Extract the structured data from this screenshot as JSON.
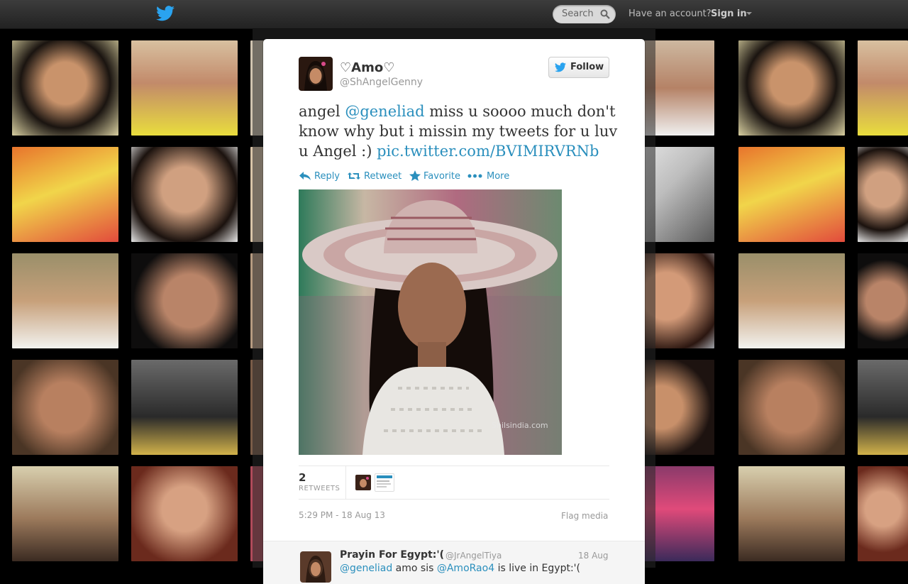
{
  "topbar": {
    "search_placeholder": "Search",
    "have_account": "Have an account?",
    "signin": "Sign in",
    "icons": [
      "twitter-bird-icon",
      "search-icon",
      "caret-down-icon"
    ]
  },
  "tweet": {
    "fullname": "♡Amo♡",
    "handle": "@ShAngelGenny",
    "follow_label": "Follow",
    "text_before": "angel ",
    "mention": "@geneliad",
    "text_middle": " miss u soooo much don't know why but i missin my tweets for u luv u Angel :) ",
    "pic_link": "pic.twitter.com/BVIMIRVRNb",
    "actions": {
      "reply": "Reply",
      "retweet": "Retweet",
      "favorite": "Favorite",
      "more": "More"
    },
    "photo_watermark": "Shilsindia.com",
    "retweet_count": "2",
    "retweets_label": "RETWEETS",
    "timestamp": "5:29 PM - 18 Aug 13",
    "flag_media": "Flag media"
  },
  "reply": {
    "name": "Prayin For Egypt:'(",
    "handle": "@JrAngelTiya",
    "date": "18 Aug",
    "mention1": "@geneliad",
    "text1": " amo sis ",
    "mention2": "@AmoRao4",
    "text2": " is live in Egypt:'("
  },
  "colors": {
    "link": "#2a8fbd",
    "topbar": "#2b2b2b",
    "card": "#ffffff"
  }
}
